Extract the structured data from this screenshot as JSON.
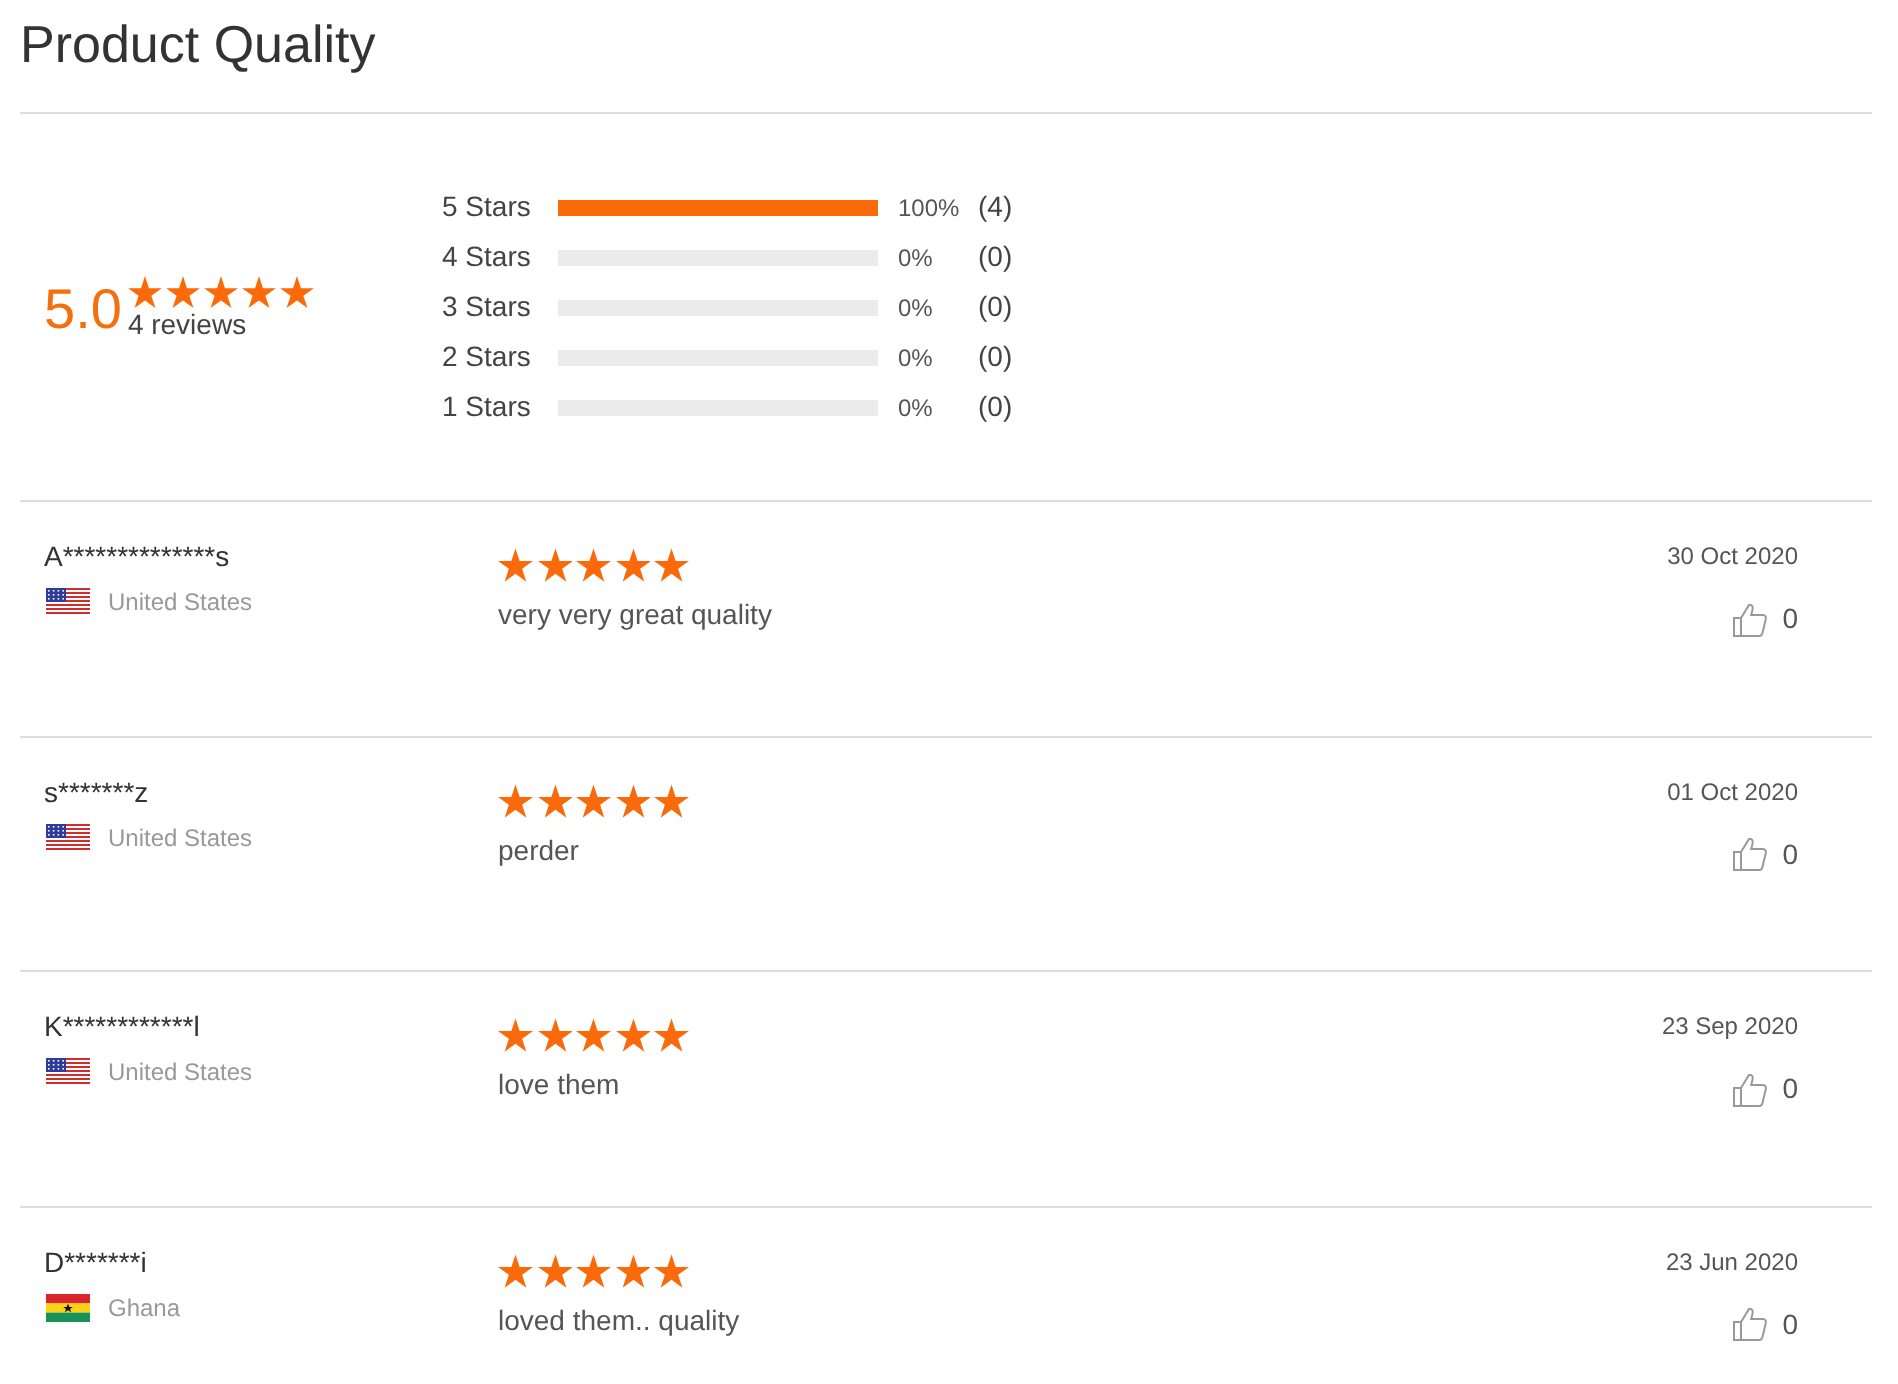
{
  "title": "Product Quality",
  "summary": {
    "score": "5.0",
    "stars": 5,
    "review_count": "4 reviews"
  },
  "histogram": [
    {
      "label": "5 Stars",
      "level": 1,
      "percent": "100%",
      "count": "(4)"
    },
    {
      "label": "4 Stars",
      "level": 0,
      "percent": "0%",
      "count": "(0)"
    },
    {
      "label": "3 Stars",
      "level": 0,
      "percent": "0%",
      "count": "(0)"
    },
    {
      "label": "2 Stars",
      "level": 0,
      "percent": "0%",
      "count": "(0)"
    },
    {
      "label": "1 Stars",
      "level": 0,
      "percent": "0%",
      "count": "(0)"
    }
  ],
  "reviews": [
    {
      "name": "A**************s",
      "kind": "us",
      "country": "United States",
      "stars": 5,
      "comment": "very very great quality",
      "date": "30 Oct 2020",
      "likes": "0"
    },
    {
      "name": "s*******z",
      "kind": "us",
      "country": "United States",
      "stars": 5,
      "comment": "perder",
      "date": "01 Oct 2020",
      "likes": "0"
    },
    {
      "name": "K************l",
      "kind": "us",
      "country": "United States",
      "stars": 5,
      "comment": "love them",
      "date": "23 Sep 2020",
      "likes": "0"
    },
    {
      "name": "D*******i",
      "kind": "gh",
      "country": "Ghana",
      "stars": 5,
      "comment": "loved them.. quality",
      "date": "23 Jun 2020",
      "likes": "0"
    }
  ]
}
